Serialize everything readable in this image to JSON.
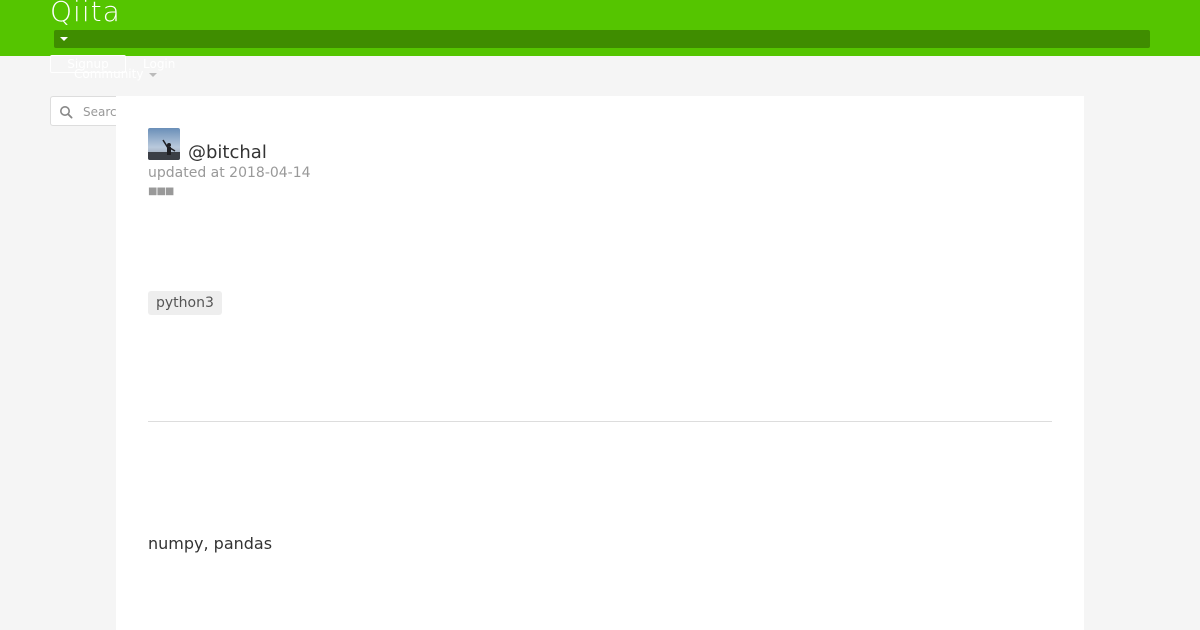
{
  "header": {
    "logo": "Qiita",
    "signup_label": "Signup",
    "login_label": "Login",
    "community_label": "Community",
    "colors": {
      "brand": "#55c500",
      "brand_dark": "#3f8d00"
    }
  },
  "search": {
    "placeholder": "Search",
    "icon": "search-icon"
  },
  "article": {
    "author": "@bitchal",
    "updated": "updated at 2018-04-14",
    "tags": [
      "python3"
    ],
    "body": "numpy, pandas"
  }
}
